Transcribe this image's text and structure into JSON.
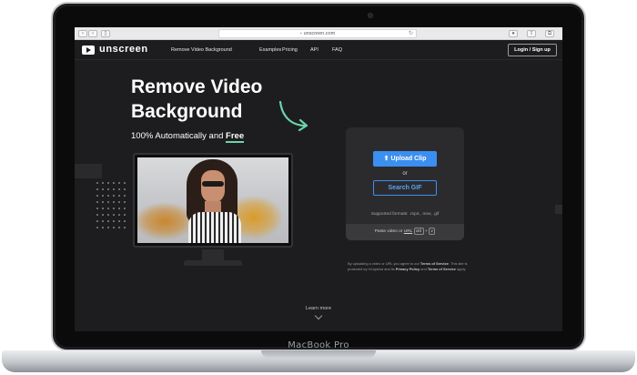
{
  "device": {
    "label": "MacBook Pro"
  },
  "browser": {
    "url": "unscreen.com",
    "icons": [
      "back-icon",
      "forward-icon",
      "sidebar-icon",
      "lock-icon",
      "reload-icon",
      "share-icon",
      "tabs-icon",
      "new-tab-icon"
    ]
  },
  "nav": {
    "logo": "unscreen",
    "links": [
      "Remove Video Background",
      "Examples",
      "Pricing",
      "API",
      "FAQ"
    ],
    "login": "Login / Sign up"
  },
  "hero": {
    "title_line1": "Remove Video",
    "title_line2": "Background",
    "subtitle_prefix": "100% Automatically and ",
    "subtitle_free": "Free"
  },
  "upload": {
    "upload_label": "Upload Clip",
    "or": "or",
    "search_label": "Search GIF",
    "formats": "Supported formats: .mp4, .mov, .gif",
    "paste_prefix": "Paste video or ",
    "paste_url": "URL",
    "kbd_ctrl": "ctrl",
    "kbd_plus": "+",
    "kbd_v": "v"
  },
  "terms": {
    "line1_a": "By uploading a video or URL you agree to our ",
    "line1_b": "Terms of Service",
    "line1_c": ". This site is",
    "line2_a": "protected by hCaptcha and its ",
    "line2_b": "Privacy Policy",
    "line2_c": " and ",
    "line2_d": "Terms of Service",
    "line2_e": " apply."
  },
  "footer": {
    "learn_more": "Learn more"
  },
  "colors": {
    "accent": "#3b8ff0",
    "highlight": "#6cd4a8",
    "background": "#1d1d1f"
  }
}
